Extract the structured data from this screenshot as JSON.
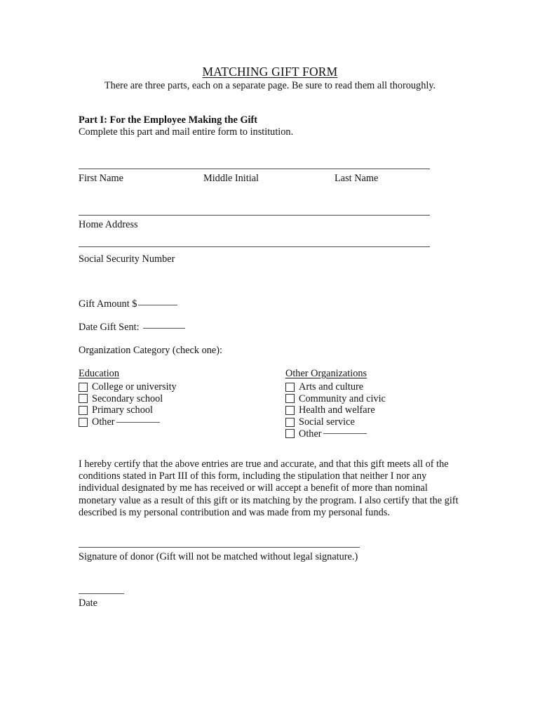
{
  "document": {
    "title": "MATCHING GIFT FORM",
    "subtitle": "There are three parts, each on a separate page.  Be sure to read them all thoroughly."
  },
  "part_one": {
    "heading": "Part I: For the Employee Making the Gift",
    "instruction": "Complete this part and mail entire form to institution."
  },
  "name_fields": {
    "first_name_label": "First Name",
    "middle_initial_label": "Middle Initial",
    "last_name_label": "Last Name"
  },
  "address_field": {
    "label": "Home Address"
  },
  "ssn_field": {
    "label": "Social Security Number"
  },
  "gift": {
    "amount_label": "Gift Amount $",
    "date_sent_label": "Date Gift Sent: ",
    "category_label": "Organization Category (check one):"
  },
  "categories": {
    "education": {
      "title": "Education",
      "options": [
        {
          "label": "College or university",
          "has_blank": false
        },
        {
          "label": "Secondary school",
          "has_blank": false
        },
        {
          "label": "Primary school",
          "has_blank": false
        },
        {
          "label": "Other",
          "has_blank": true
        }
      ]
    },
    "other_organizations": {
      "title": "Other Organizations",
      "options": [
        {
          "label": "Arts and culture",
          "has_blank": false
        },
        {
          "label": "Community and civic",
          "has_blank": false
        },
        {
          "label": "Health and welfare",
          "has_blank": false
        },
        {
          "label": "Social service",
          "has_blank": false
        },
        {
          "label": "Other",
          "has_blank": true
        }
      ]
    }
  },
  "certification": {
    "text": "I hereby certify that the above entries are true and accurate, and that this gift meets all of the conditions stated in Part III of this form, including the stipulation that neither I nor any individual designated by me has received or will accept a benefit of more than nominal monetary value as a result of this gift or its matching by the program. I also certify that the gift described is my personal contribution and was made from my personal funds."
  },
  "signature": {
    "label": "Signature of donor (Gift will not be matched without legal signature.)"
  },
  "date": {
    "label": "Date"
  }
}
